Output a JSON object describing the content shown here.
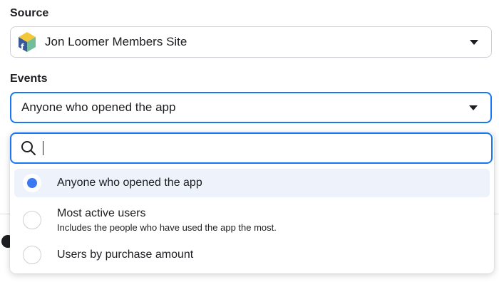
{
  "source": {
    "label": "Source",
    "value": "Jon Loomer Members Site",
    "icon": "facebook-app-cube-icon"
  },
  "events": {
    "label": "Events",
    "value": "Anyone who opened the app"
  },
  "dropdown": {
    "search_value": "",
    "options": [
      {
        "title": "Anyone who opened the app",
        "description": "",
        "selected": true
      },
      {
        "title": "Most active users",
        "description": "Includes the people who have used the app the most.",
        "selected": false
      },
      {
        "title": "Users by purchase amount",
        "description": "",
        "selected": false
      }
    ]
  },
  "colors": {
    "accent": "#1877f2",
    "radio_selected": "#3b79f2",
    "selected_row_bg": "#eef3fb",
    "text": "#1c1e21",
    "border": "#ccd0d5"
  }
}
